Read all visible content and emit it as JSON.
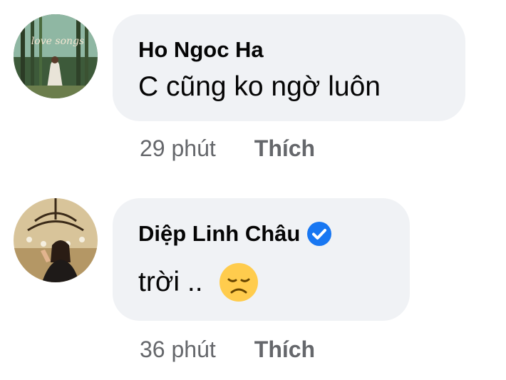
{
  "comments": [
    {
      "author": "Ho Ngoc Ha",
      "avatar_icon": "profile-photo-love-songs-album",
      "avatar_text": "love songs",
      "verified": false,
      "text": "C cũng ko ngờ luôn",
      "time": "29 phút",
      "like_label": "Thích"
    },
    {
      "author": "Diệp Linh Châu",
      "avatar_icon": "profile-photo-chandelier",
      "verified": true,
      "verified_icon": "verified-badge-icon",
      "text": "trời ..",
      "emoji_icon": "disappointed-face-emoji",
      "time": "36 phút",
      "like_label": "Thích"
    }
  ],
  "colors": {
    "bubble": "#f0f2f5",
    "text": "#050505",
    "meta": "#65676b",
    "verified": "#1877f2",
    "emoji": "#ffcc4d"
  }
}
